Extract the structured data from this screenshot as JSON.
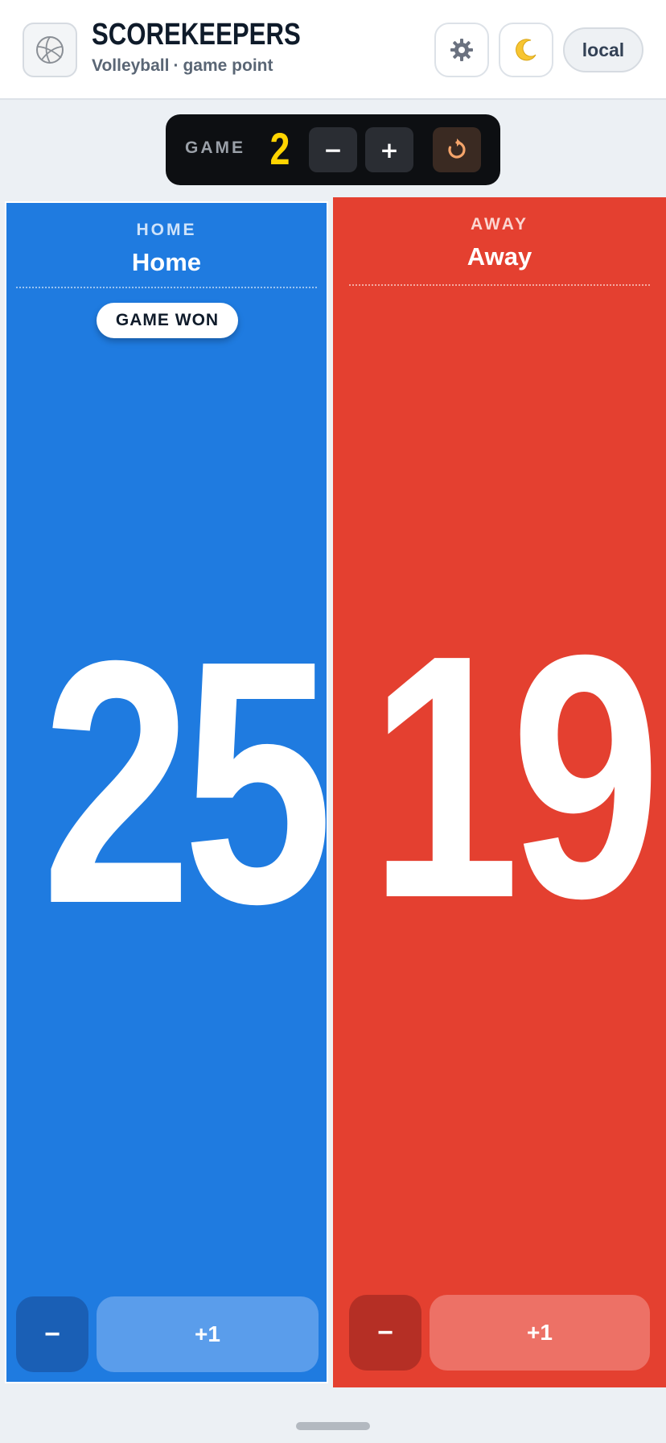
{
  "header": {
    "title": "SCOREKEEPERS",
    "sport": "Volleyball",
    "separator": "·",
    "mode": "game point",
    "local_label": "local"
  },
  "game": {
    "label": "GAME",
    "number": "2",
    "minus_label": "−",
    "plus_label": "+"
  },
  "home": {
    "tag": "HOME",
    "name": "Home",
    "badge": "GAME WON",
    "score": "25",
    "minus_label": "−",
    "plus_label": "+1",
    "color": "#1f7be0"
  },
  "away": {
    "tag": "AWAY",
    "name": "Away",
    "score": "19",
    "minus_label": "−",
    "plus_label": "+1",
    "color": "#e44030"
  },
  "icons": {
    "logo": "volleyball-icon",
    "settings": "gear-icon",
    "theme": "moon-icon",
    "reset": "reset-icon"
  }
}
